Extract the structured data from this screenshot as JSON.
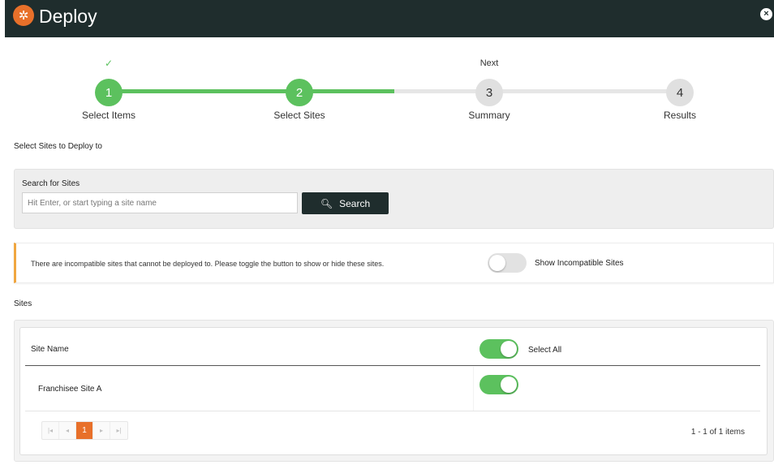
{
  "header": {
    "title": "Deploy",
    "close_icon": "×",
    "logo_icon": "✲"
  },
  "stepper": {
    "steps": [
      {
        "number": "1",
        "label": "Select Items",
        "above": "✓"
      },
      {
        "number": "2",
        "label": "Select Sites",
        "above": ""
      },
      {
        "number": "3",
        "label": "Summary",
        "above": "Next"
      },
      {
        "number": "4",
        "label": "Results",
        "above": ""
      }
    ],
    "progress": 0.5
  },
  "page": {
    "heading": "Select Sites to Deploy to"
  },
  "search": {
    "label": "Search for Sites",
    "placeholder": "Hit Enter, or start typing a site name",
    "value": "",
    "button_label": "Search"
  },
  "alert": {
    "message": "There are incompatible sites that cannot be deployed to. Please toggle the button to show or hide these sites.",
    "toggle_label": "Show Incompatible Sites",
    "toggle_on": false
  },
  "sites": {
    "heading": "Sites",
    "column_header": "Site Name",
    "select_all_label": "Select All",
    "select_all_on": true,
    "rows": [
      {
        "name": "Franchisee Site A",
        "selected": true
      }
    ],
    "pager": {
      "first": "|◂",
      "prev": "◂",
      "current": "1",
      "next": "▸",
      "last": "▸|"
    },
    "page_info": "1 - 1 of 1 items"
  },
  "colors": {
    "header_bg": "#1f2d2d",
    "accent_orange": "#e8702a",
    "success_green": "#5cc15e",
    "warning_border": "#f0a640"
  }
}
